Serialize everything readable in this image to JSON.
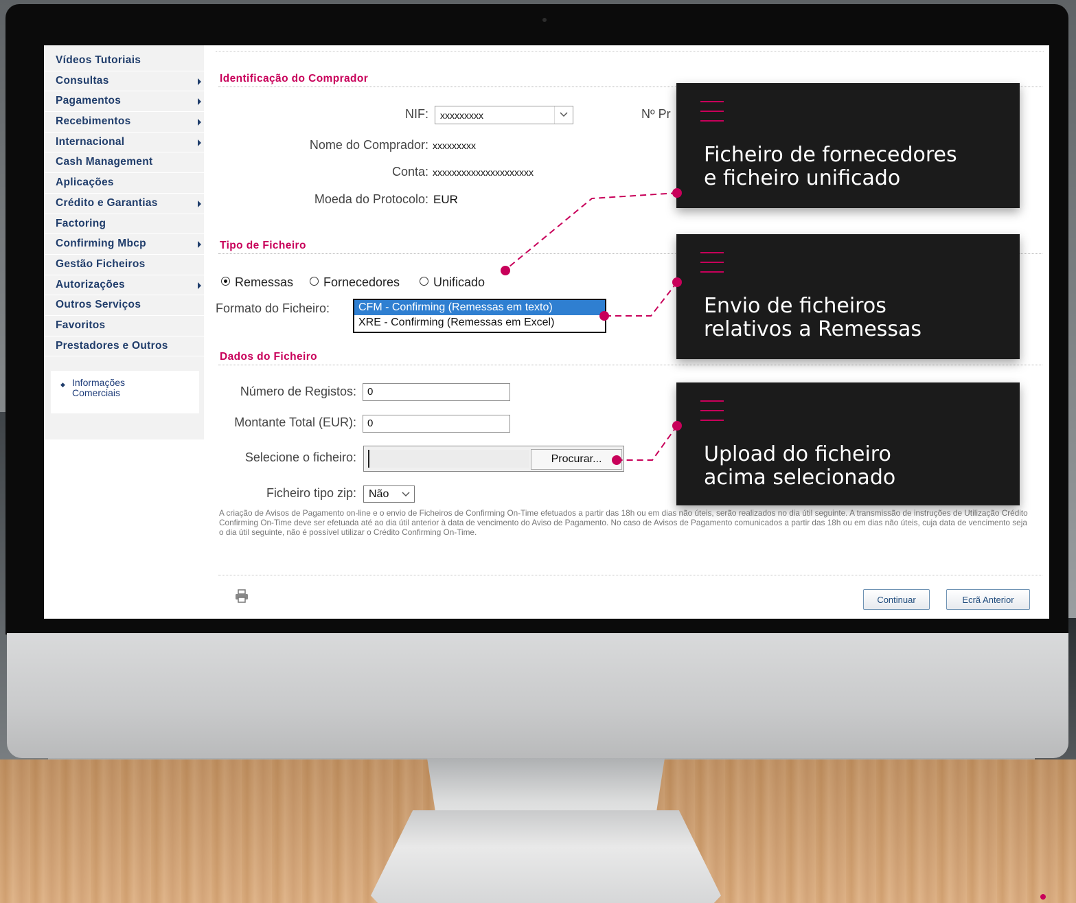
{
  "sidebar": {
    "items": [
      {
        "label": "Vídeos Tutoriais",
        "has_submenu": false
      },
      {
        "label": "Consultas",
        "has_submenu": true
      },
      {
        "label": "Pagamentos",
        "has_submenu": true
      },
      {
        "label": "Recebimentos",
        "has_submenu": true
      },
      {
        "label": "Internacional",
        "has_submenu": true
      },
      {
        "label": "Cash Management",
        "has_submenu": false
      },
      {
        "label": "Aplicações",
        "has_submenu": false
      },
      {
        "label": "Crédito e Garantias",
        "has_submenu": true
      },
      {
        "label": "Factoring",
        "has_submenu": false
      },
      {
        "label": "Confirming Mbcp",
        "has_submenu": true
      },
      {
        "label": "Gestão Ficheiros",
        "has_submenu": false
      },
      {
        "label": "Autorizações",
        "has_submenu": true
      },
      {
        "label": "Outros Serviços",
        "has_submenu": false
      },
      {
        "label": "Favoritos",
        "has_submenu": false
      },
      {
        "label": "Prestadores e Outros",
        "has_submenu": false
      }
    ],
    "info_link": "Informações Comerciais"
  },
  "buyer": {
    "section_title": "Identificação do Comprador",
    "nif_label": "NIF:",
    "nif_value": "xxxxxxxxx",
    "protocol_label_partial": "Nº Pr",
    "name_label": "Nome do Comprador:",
    "name_value": "xxxxxxxxx",
    "account_label": "Conta:",
    "account_value": "xxxxxxxxxxxxxxxxxxxxx",
    "currency_label": "Moeda do Protocolo:",
    "currency_value": "EUR"
  },
  "file_type": {
    "section_title": "Tipo de Ficheiro",
    "options": [
      "Remessas",
      "Fornecedores",
      "Unificado"
    ],
    "selected": "Remessas",
    "format_label": "Formato do Ficheiro:",
    "format_options": [
      "CFM - Confirming (Remessas em texto)",
      "XRE - Confirming (Remessas em Excel)"
    ],
    "format_selected": "CFM - Confirming (Remessas em texto)"
  },
  "file_data": {
    "section_title": "Dados do Ficheiro",
    "records_label": "Número de Registos:",
    "records_value": "0",
    "amount_label": "Montante Total (EUR):",
    "amount_value": "0",
    "file_label": "Selecione o ficheiro:",
    "browse_label": "Procurar...",
    "zip_label": "Ficheiro tipo zip:",
    "zip_value": "Não"
  },
  "notice": "A criação de Avisos de Pagamento on-line e o envio de Ficheiros de Confirming On-Time efetuados a partir das 18h ou em dias não úteis, serão realizados no dia útil seguinte. A transmissão de instruções de Utilização Crédito Confirming On-Time deve ser efetuada até ao dia útil anterior à data de vencimento do Aviso de Pagamento. No caso de Avisos de Pagamento comunicados a partir das 18h ou em dias não úteis, cuja data de vencimento seja o dia útil seguinte, não é possível utilizar o Crédito Confirming On-Time.",
  "buttons": {
    "continue": "Continuar",
    "back": "Ecrã Anterior"
  },
  "callouts": [
    {
      "line1": "Ficheiro de fornecedores",
      "line2": "e ficheiro unificado"
    },
    {
      "line1": "Envio de ficheiros",
      "line2": "relativos a Remessas"
    },
    {
      "line1": "Upload do ficheiro",
      "line2": "acima selecionado"
    }
  ],
  "colors": {
    "accent": "#c8005a",
    "nav_text": "#203d6b",
    "callout_bg": "#1b1b1b",
    "selected_option": "#2f7fd1"
  },
  "icons": [
    "chevron-down-icon",
    "print-icon",
    "menu-bars-icon",
    "submenu-arrow-icon"
  ]
}
